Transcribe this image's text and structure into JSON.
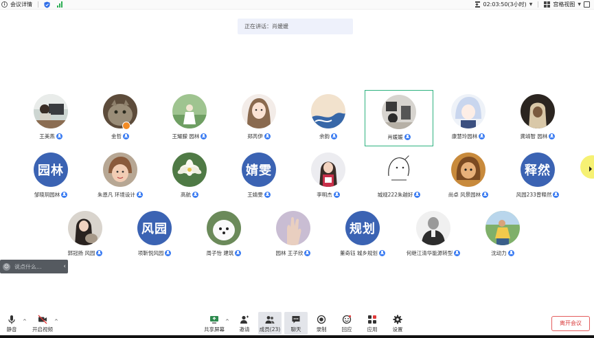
{
  "topbar": {
    "meeting_info": "会议详情",
    "timer": "02:03:50(3小时)",
    "layout_label": "宫格视图"
  },
  "speaking": {
    "text": "正在讲话：肖媛媛"
  },
  "participants": [
    {
      "name": "王美燕",
      "avatar_text": ""
    },
    {
      "name": "金哲",
      "avatar_text": ""
    },
    {
      "name": "王耀朦  园林",
      "avatar_text": ""
    },
    {
      "name": "郑芮伊",
      "avatar_text": ""
    },
    {
      "name": "余韵",
      "avatar_text": ""
    },
    {
      "name": "肖媛媛",
      "avatar_text": ""
    },
    {
      "name": "康慧玲园林",
      "avatar_text": ""
    },
    {
      "name": "龚靖智 园林",
      "avatar_text": ""
    },
    {
      "name": "邹晓玥园林",
      "avatar_text": "园林"
    },
    {
      "name": "朱恩凡 环境设计",
      "avatar_text": ""
    },
    {
      "name": "高航",
      "avatar_text": ""
    },
    {
      "name": "王婧雯",
      "avatar_text": "婧雯"
    },
    {
      "name": "李明杰",
      "avatar_text": ""
    },
    {
      "name": "城规222朱越好",
      "avatar_text": ""
    },
    {
      "name": "尚卓 风景园林",
      "avatar_text": ""
    },
    {
      "name": "风园233曾释然",
      "avatar_text": "释然"
    },
    {
      "name": "郭冠扬 风园",
      "avatar_text": ""
    },
    {
      "name": "项靳悦风园",
      "avatar_text": "风园"
    },
    {
      "name": "周子怡 建筑",
      "avatar_text": ""
    },
    {
      "name": "园林 王子欣",
      "avatar_text": ""
    },
    {
      "name": "董奇钰 城乡规划",
      "avatar_text": "规划"
    },
    {
      "name": "何继江清华能源转型",
      "avatar_text": ""
    },
    {
      "name": "沈动力",
      "avatar_text": ""
    }
  ],
  "chat": {
    "placeholder": "说点什么..."
  },
  "toolbar": {
    "mute": "静音",
    "video": "开启视频",
    "share": "共享屏幕",
    "invite": "邀请",
    "members": "成员(23)",
    "chat": "聊天",
    "record": "录制",
    "react": "回应",
    "apps": "应用",
    "settings": "设置",
    "leave": "离开会议"
  },
  "colors": {
    "accent": "#3b7cf2",
    "active_border": "#2cb17e",
    "text_avatar": "#3b63b3",
    "leave": "#d93a3a"
  }
}
